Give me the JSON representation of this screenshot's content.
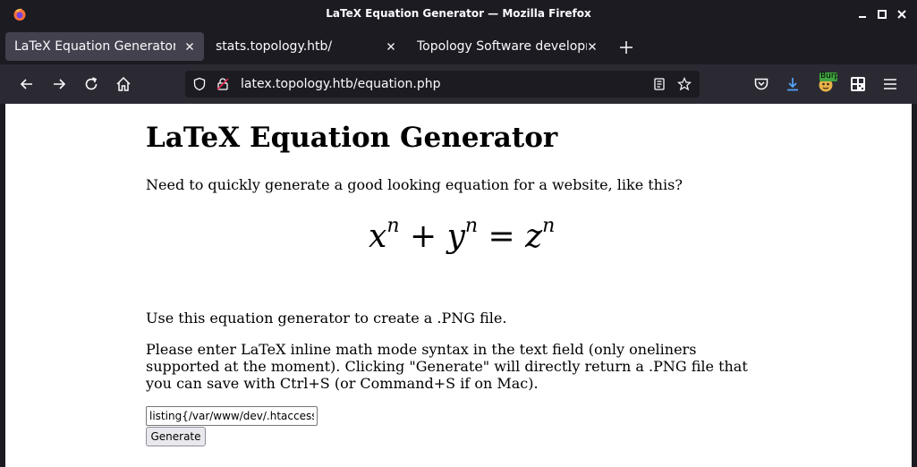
{
  "window": {
    "title": "LaTeX Equation Generator — Mozilla Firefox"
  },
  "tabs": [
    {
      "label": "LaTeX Equation Generator",
      "active": true
    },
    {
      "label": "stats.topology.htb/",
      "active": false
    },
    {
      "label": "Topology Software developm",
      "active": false
    }
  ],
  "navbar": {
    "url": "latex.topology.htb/equation.php",
    "extension_badge": "Burp"
  },
  "page": {
    "heading": "LaTeX Equation Generator",
    "intro": "Need to quickly generate a good looking equation for a website, like this?",
    "equation": {
      "x": "x",
      "n1": "n",
      "plus": "+",
      "y": "y",
      "n2": "n",
      "eq": "=",
      "z": "z",
      "n3": "n"
    },
    "usage": "Use this equation generator to create a .PNG file.",
    "instructions": "Please enter LaTeX inline math mode syntax in the text field (only oneliners supported at the moment). Clicking \"Generate\" will directly return a .PNG file that you can save with Ctrl+S (or Command+S if on Mac).",
    "input_value": "listing{/var/www/dev/.htaccess",
    "generate_label": "Generate"
  },
  "colors": {
    "chrome_dark": "#1c1b22",
    "toolbar": "#2b2a33",
    "active_tab": "#42414d",
    "download_accent": "#54a3ff"
  }
}
